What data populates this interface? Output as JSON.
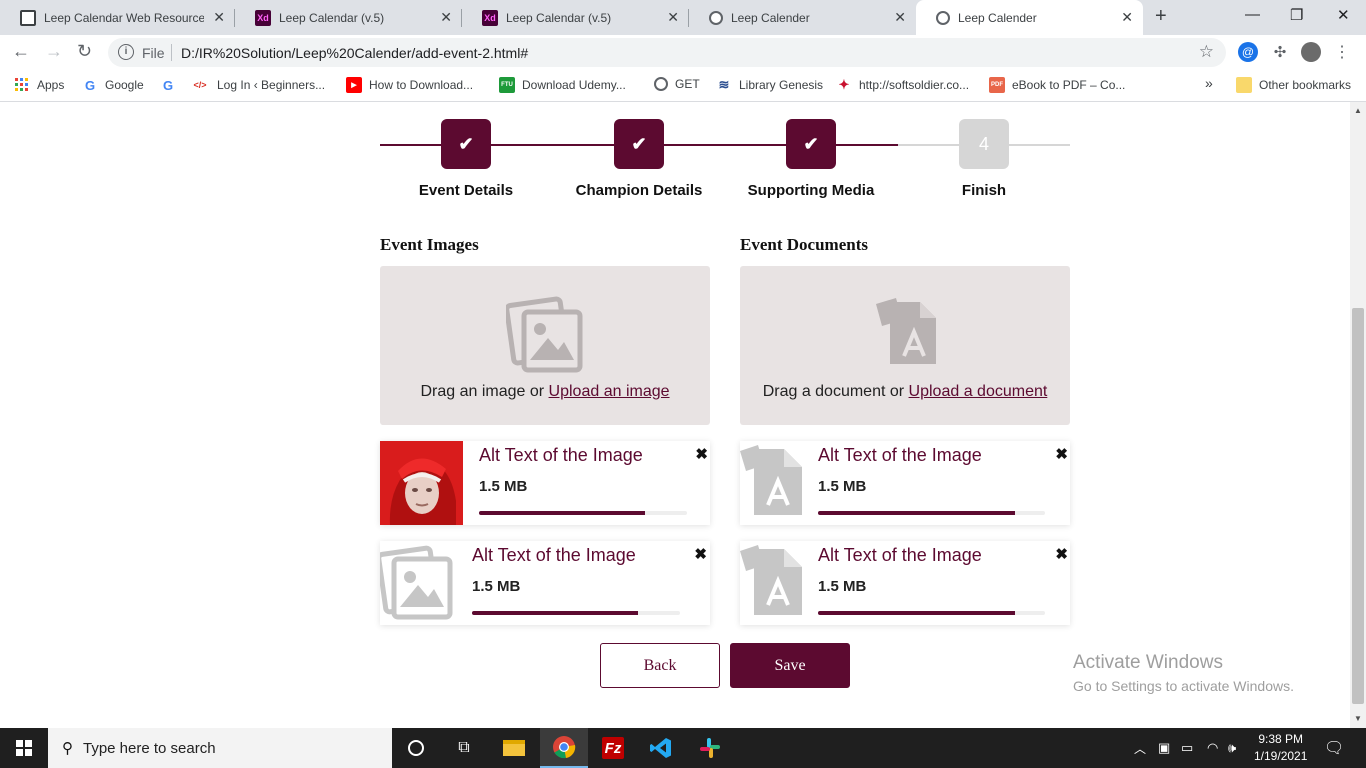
{
  "browser": {
    "tabs": [
      {
        "title": "Leep Calendar Web Resources",
        "icon": "doc-icon"
      },
      {
        "title": "Leep Calendar (v.5)",
        "icon": "xd-icon"
      },
      {
        "title": "Leep Calendar (v.5)",
        "icon": "xd-icon"
      },
      {
        "title": "Leep Calender",
        "icon": "globe-icon"
      },
      {
        "title": "Leep Calender",
        "icon": "globe-icon",
        "active": true
      }
    ],
    "xd_glyph": "Xd",
    "address": {
      "scheme": "File",
      "url": "D:/IR%20Solution/Leep%20Calender/add-event-2.html#",
      "info_glyph": "i"
    },
    "bookmarks": [
      {
        "label": "Apps",
        "icon": "apps-grid-icon"
      },
      {
        "label": "Google",
        "icon": "google-icon",
        "glyph": "G"
      },
      {
        "label": "Log In ‹ Beginners...",
        "icon": "code-icon",
        "glyph": "</>"
      },
      {
        "label": "How to Download...",
        "icon": "youtube-icon",
        "glyph": "▶"
      },
      {
        "label": "Download Udemy...",
        "icon": "ftu-icon",
        "glyph": "FTU"
      },
      {
        "label": "GET",
        "icon": "globe-icon"
      },
      {
        "label": "Library Genesis",
        "icon": "library-icon"
      },
      {
        "label": "http://softsoldier.co...",
        "icon": "soldier-icon"
      },
      {
        "label": "eBook to PDF – Co...",
        "icon": "pdf-icon",
        "glyph": "PDF"
      }
    ],
    "bookmarks_more": "»",
    "other_bookmarks": "Other bookmarks",
    "google_glyph": "G"
  },
  "steps": [
    {
      "label": "Event Details",
      "state": "done",
      "glyph": "✔"
    },
    {
      "label": "Champion Details",
      "state": "done",
      "glyph": "✔"
    },
    {
      "label": "Supporting Media",
      "state": "done",
      "glyph": "✔"
    },
    {
      "label": "Finish",
      "state": "pending",
      "glyph": "4"
    }
  ],
  "images": {
    "title": "Event Images",
    "drop_text": "Drag an image or ",
    "drop_link": "Upload an image",
    "files": [
      {
        "name": "Alt Text of the Image",
        "size": "1.5 MB",
        "progress": 0.8,
        "thumb": "photo"
      },
      {
        "name": "Alt Text of the Image",
        "size": "1.5 MB",
        "progress": 0.8,
        "thumb": "image-placeholder"
      }
    ]
  },
  "documents": {
    "title": "Event Documents",
    "drop_text": "Drag a document or ",
    "drop_link": "Upload a document",
    "files": [
      {
        "name": "Alt Text of the Image",
        "size": "1.5 MB",
        "progress": 0.87,
        "thumb": "pdf"
      },
      {
        "name": "Alt Text of the Image",
        "size": "1.5 MB",
        "progress": 0.87,
        "thumb": "pdf"
      }
    ]
  },
  "remove_glyph": "✖",
  "actions": {
    "back": "Back",
    "save": "Save"
  },
  "watermark": {
    "line1": "Activate Windows",
    "line2": "Go to Settings to activate Windows."
  },
  "taskbar": {
    "search_placeholder": "Type here to search",
    "time": "9:38 PM",
    "date": "1/19/2021"
  },
  "colors": {
    "accent": "#5c0a30",
    "pending": "#d6d6d6",
    "dropzone": "#e8e3e3"
  }
}
